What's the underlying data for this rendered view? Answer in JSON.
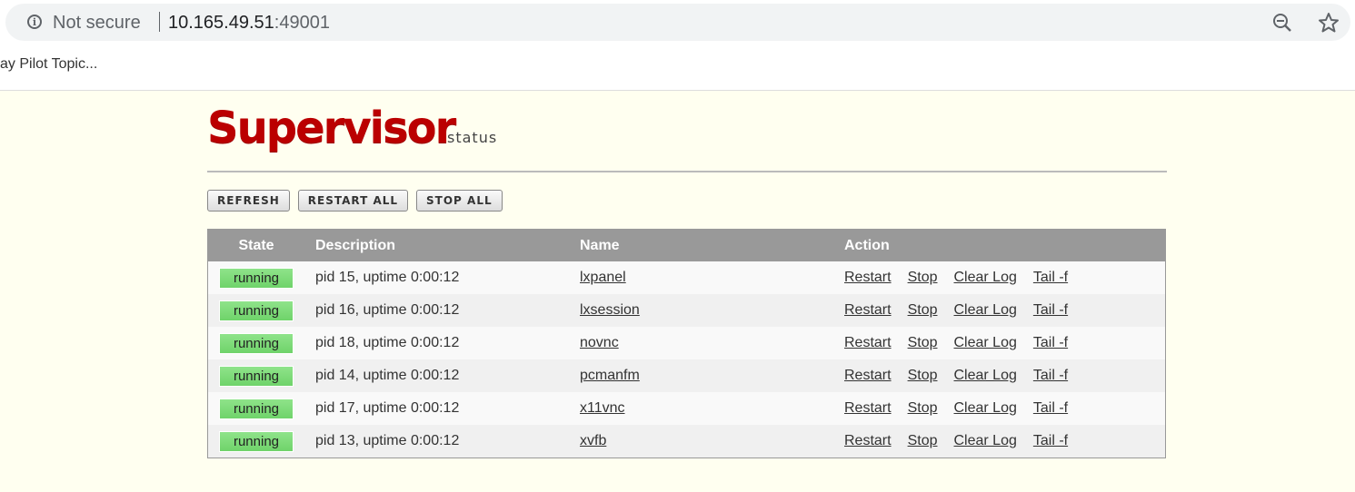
{
  "browser": {
    "security_label": "Not secure",
    "url_host": "10.165.49.51",
    "url_port": ":49001",
    "bookmark": "vay Pilot Topic..."
  },
  "page": {
    "logo_main": "Supervisor",
    "logo_sub": "status",
    "buttons": {
      "refresh": "REFRESH",
      "restart_all": "RESTART ALL",
      "stop_all": "STOP ALL"
    },
    "table": {
      "headers": {
        "state": "State",
        "description": "Description",
        "name": "Name",
        "action": "Action"
      },
      "actions": [
        "Restart",
        "Stop",
        "Clear Log",
        "Tail -f"
      ],
      "rows": [
        {
          "state": "running",
          "description": "pid 15, uptime 0:00:12",
          "name": "lxpanel"
        },
        {
          "state": "running",
          "description": "pid 16, uptime 0:00:12",
          "name": "lxsession"
        },
        {
          "state": "running",
          "description": "pid 18, uptime 0:00:12",
          "name": "novnc"
        },
        {
          "state": "running",
          "description": "pid 14, uptime 0:00:12",
          "name": "pcmanfm"
        },
        {
          "state": "running",
          "description": "pid 17, uptime 0:00:12",
          "name": "x11vnc"
        },
        {
          "state": "running",
          "description": "pid 13, uptime 0:00:12",
          "name": "xvfb"
        }
      ]
    }
  }
}
